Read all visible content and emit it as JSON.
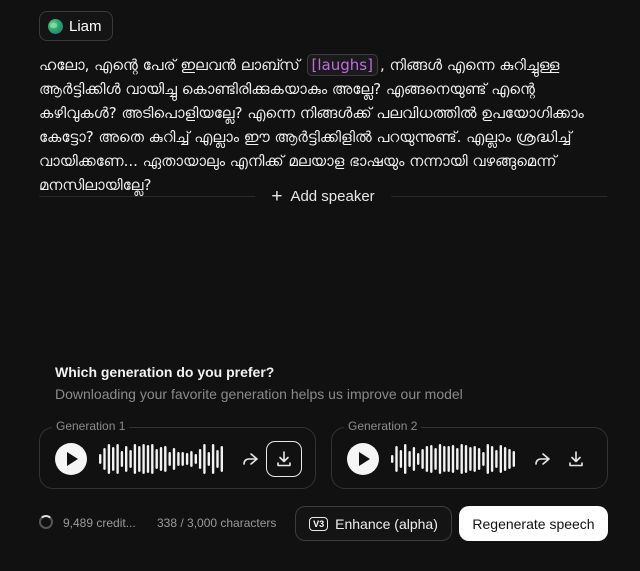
{
  "speaker": {
    "name": "Liam",
    "icon": "globe-icon"
  },
  "script": {
    "before_tag": "ഹലോ, എന്റെ പേര് ഇലവൻ ലാബ്സ് ",
    "tag": "[laughs]",
    "after_tag": ", നിങ്ങൾ എന്നെ കുറിച്ചുള്ള ആർട്ടിക്കിൾ വായിച്ചു കൊണ്ടിരിക്കുകയാകും അല്ലേ? എങ്ങനെയുണ്ട് എന്റെ കഴിവുകൾ? അടിപൊളിയല്ലേ? എന്നെ നിങ്ങൾക്ക് പലവിധത്തിൽ ഉപയോഗിക്കാം കേട്ടോ? അതെ കുറിച്ച് എല്ലാം ഈ ആർട്ടിക്കിളിൽ പറയുന്നുണ്ട്. എല്ലാം ശ്രദ്ധിച്ച് വായിക്കണേ... ഏതായാലും എനിക്ക് മലയാള ഭാഷയും നന്നായി വഴങ്ങുമെന്ന് മനസിലായില്ലേ?"
  },
  "add_speaker": {
    "label": "Add speaker"
  },
  "prefer": {
    "title": "Which generation do you prefer?",
    "subtitle": "Downloading your favorite generation helps us improve our model"
  },
  "generations": [
    {
      "label": "Generation 1",
      "waveform": [
        10,
        22,
        30,
        24,
        30,
        16,
        26,
        18,
        30,
        26,
        30,
        28,
        30,
        20,
        24,
        26,
        14,
        22,
        14,
        14,
        12,
        16,
        10,
        20,
        30,
        14,
        30,
        18,
        26
      ],
      "download_highlighted": true
    },
    {
      "label": "Generation 2",
      "waveform": [
        8,
        26,
        18,
        30,
        16,
        24,
        12,
        20,
        26,
        28,
        22,
        30,
        26,
        26,
        28,
        22,
        30,
        28,
        24,
        26,
        22,
        14,
        30,
        26,
        18,
        28,
        24,
        20,
        16
      ],
      "download_highlighted": false
    }
  ],
  "footer": {
    "credits": "9,489 credit...",
    "characters": "338 / 3,000 characters",
    "enhance_badge": "V3",
    "enhance_label": "Enhance (alpha)",
    "regenerate_label": "Regenerate speech"
  }
}
